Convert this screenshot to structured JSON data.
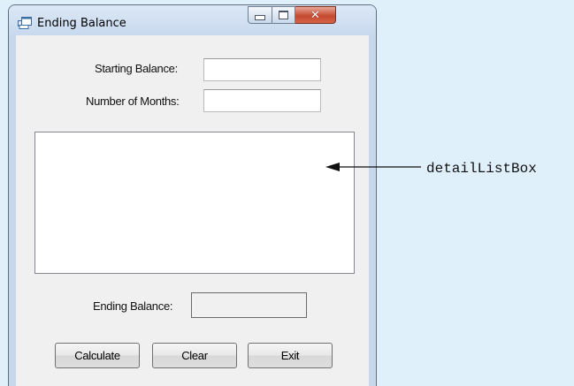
{
  "window": {
    "title": "Ending Balance"
  },
  "form": {
    "starting_balance_label": "Starting Balance:",
    "starting_balance_value": "",
    "months_label": "Number of Months:",
    "months_value": "",
    "ending_balance_label": "Ending Balance:",
    "ending_balance_value": ""
  },
  "buttons": {
    "calculate": "Calculate",
    "clear": "Clear",
    "exit": "Exit"
  },
  "annotation": {
    "text": "detailListBox"
  },
  "icons": {
    "app": "app-window-icon",
    "minimize": "minimize-icon",
    "maximize": "maximize-icon",
    "close": "close-icon",
    "arrow": "arrow-left-icon"
  },
  "colors": {
    "background": "#e0f0fb",
    "window_frame": "#c7d8ec",
    "client_area": "#f0f0f0",
    "close_button": "#c44a2e"
  }
}
